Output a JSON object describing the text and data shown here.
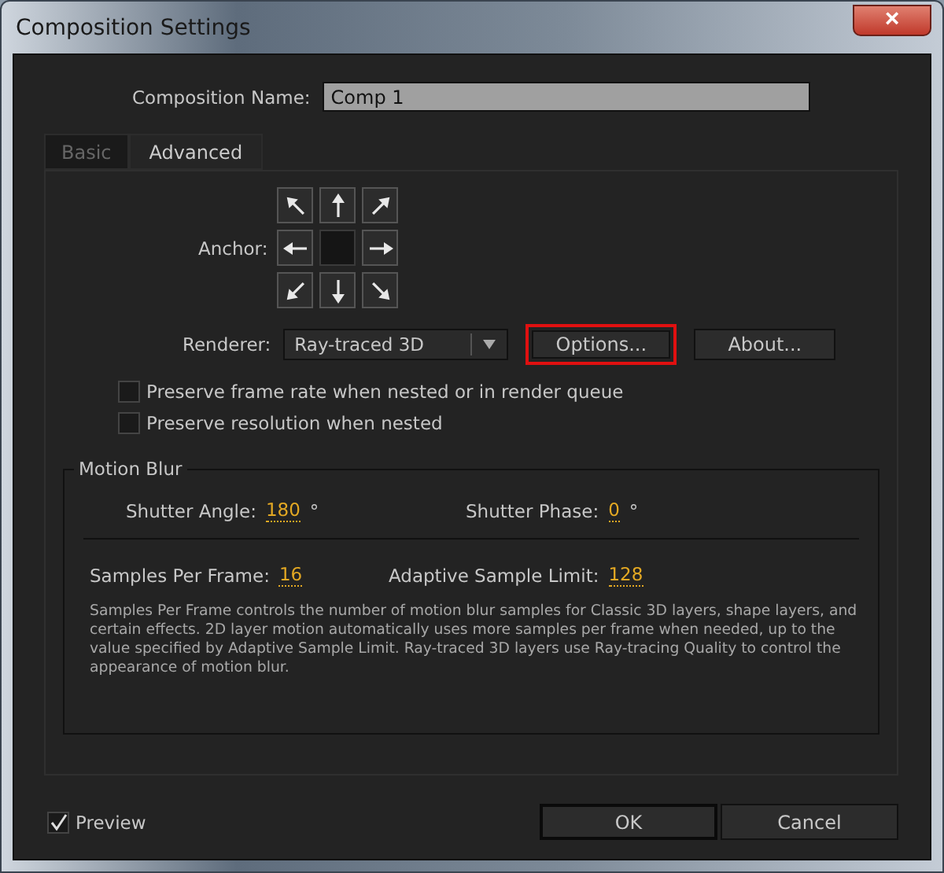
{
  "window": {
    "title": "Composition Settings",
    "close": "×"
  },
  "name_field": {
    "label": "Composition Name:",
    "value": "Comp 1"
  },
  "tabs": [
    {
      "label": "Basic",
      "selected": false
    },
    {
      "label": "Advanced",
      "selected": true
    }
  ],
  "anchor": {
    "label": "Anchor:",
    "cells": [
      {
        "selected": false
      },
      {
        "selected": false
      },
      {
        "selected": false
      },
      {
        "selected": false
      },
      {
        "selected": true
      },
      {
        "selected": false
      },
      {
        "selected": false
      },
      {
        "selected": false
      },
      {
        "selected": false
      }
    ]
  },
  "renderer": {
    "label": "Renderer:",
    "value": "Ray-traced 3D",
    "buttons": [
      {
        "label": "Options...",
        "highlighted": true
      },
      {
        "label": "About...",
        "highlighted": false
      }
    ]
  },
  "options": [
    {
      "label": "Preserve frame rate when nested or in render queue",
      "checked": false
    },
    {
      "label": "Preserve resolution when nested",
      "checked": false
    }
  ],
  "motion_blur": {
    "title": "Motion Blur",
    "row1": [
      {
        "label": "Shutter Angle:",
        "value": "180",
        "unit": "°"
      },
      {
        "label": "Shutter Phase:",
        "value": "0",
        "unit": "°"
      }
    ],
    "row2": [
      {
        "label": "Samples Per Frame:",
        "value": "16"
      },
      {
        "label": "Adaptive Sample Limit:",
        "value": "128"
      }
    ],
    "description": "Samples Per Frame controls the number of motion blur samples for Classic 3D layers, shape layers, and certain effects. 2D layer motion automatically uses more samples per frame when needed, up to the value specified by Adaptive Sample Limit. Ray-traced 3D layers use Ray-tracing Quality to control the appearance of motion blur."
  },
  "preview": {
    "label": "Preview",
    "checked": true
  },
  "buttons": [
    {
      "label": "OK"
    },
    {
      "label": "Cancel"
    }
  ]
}
